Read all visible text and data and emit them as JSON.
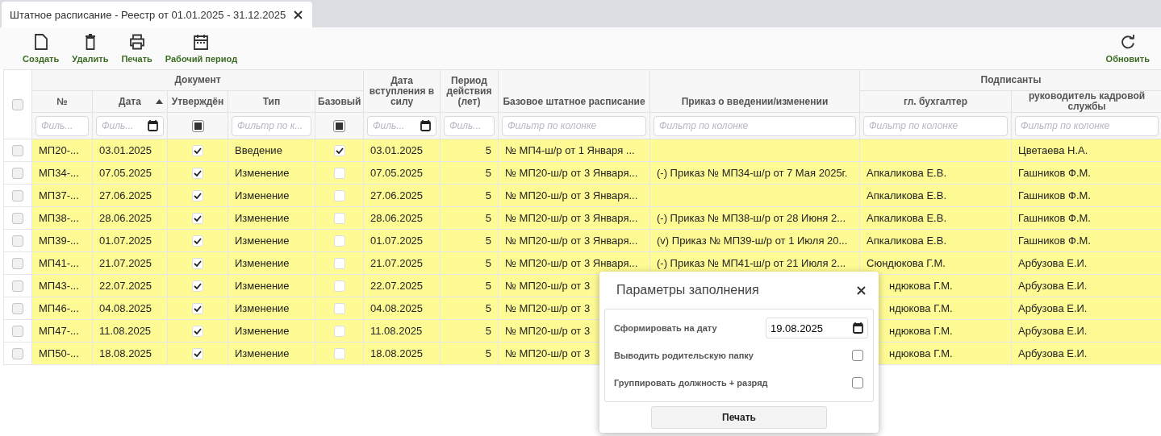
{
  "tab": {
    "title": "Штатное расписание - Реестр от 01.01.2025 - 31.12.2025",
    "closable": true
  },
  "toolbar": {
    "buttons": [
      {
        "kind": "create",
        "label": "Создать"
      },
      {
        "kind": "delete",
        "label": "Удалить"
      },
      {
        "kind": "print",
        "label": "Печать"
      },
      {
        "kind": "period",
        "label": "Рабочий период"
      }
    ],
    "refresh": {
      "kind": "refresh",
      "label": "Обновить"
    }
  },
  "table": {
    "select_all": {
      "checked": false
    },
    "header": [
      {
        "kind": "group",
        "label": "Документ",
        "columns": [
          {
            "label": "№",
            "kind": "text",
            "sorted": false,
            "filter": {
              "kind": "text",
              "placeholder": "Филь..."
            }
          },
          {
            "label": "Дата",
            "kind": "text",
            "sorted": true,
            "filter": {
              "kind": "date",
              "placeholder": "Филь..."
            }
          },
          {
            "label": "Утверждён",
            "kind": "check",
            "sorted": false,
            "filter": {
              "kind": "check",
              "indeterminate": true
            }
          },
          {
            "label": "Тип",
            "kind": "text",
            "sorted": false,
            "filter": {
              "kind": "text",
              "placeholder": "Фильтр по к..."
            }
          },
          {
            "label": "Базовый",
            "kind": "check",
            "sorted": false,
            "filter": {
              "kind": "check",
              "indeterminate": true
            }
          }
        ]
      },
      {
        "kind": "single",
        "column": {
          "label": "Дата вступления в силу",
          "kind": "text",
          "sorted": false,
          "filter": {
            "kind": "date",
            "placeholder": "Филь..."
          }
        }
      },
      {
        "kind": "single",
        "column": {
          "label": "Период действия (лет)",
          "kind": "number",
          "sorted": false,
          "filter": {
            "kind": "text",
            "placeholder": "Филь..."
          }
        }
      },
      {
        "kind": "single",
        "column": {
          "label": "Базовое штатное расписание",
          "kind": "text",
          "sorted": false,
          "filter": {
            "kind": "text",
            "placeholder": "Фильтр по колонке"
          }
        }
      },
      {
        "kind": "single",
        "column": {
          "label": "Приказ о введении/изменении",
          "kind": "text",
          "sorted": false,
          "filter": {
            "kind": "text",
            "placeholder": "Фильтр по колонке"
          }
        }
      },
      {
        "kind": "group",
        "label": "Подписанты",
        "columns": [
          {
            "label": "гл. бухгалтер",
            "kind": "text",
            "sorted": false,
            "filter": {
              "kind": "text",
              "placeholder": "Фильтр по колонке"
            }
          },
          {
            "label": "руководитель кадровой службы",
            "kind": "text",
            "sorted": false,
            "filter": {
              "kind": "text",
              "placeholder": "Фильтр по колонке"
            }
          }
        ]
      }
    ],
    "rows": [
      {
        "selected": false,
        "highlighted": true,
        "cells": [
          "МП20-...",
          "03.01.2025",
          true,
          "Введение",
          true,
          "03.01.2025",
          "5",
          "№ МП4-ш/р от 1 Января ...",
          null,
          null,
          "Цветаева Н.А."
        ]
      },
      {
        "selected": false,
        "highlighted": true,
        "cells": [
          "МП34-...",
          "07.05.2025",
          true,
          "Изменение",
          false,
          "07.05.2025",
          "5",
          "№ МП20-ш/р от 3 Января...",
          "(-) Приказ № МП34-ш/р от 7 Мая 2025г.",
          "Апкаликова Е.В.",
          "Гашников Ф.М."
        ]
      },
      {
        "selected": false,
        "highlighted": true,
        "cells": [
          "МП37-...",
          "27.06.2025",
          true,
          "Изменение",
          false,
          "27.06.2025",
          "5",
          "№ МП20-ш/р от 3 Января...",
          null,
          "Апкаликова Е.В.",
          "Гашников Ф.М."
        ]
      },
      {
        "selected": false,
        "highlighted": true,
        "cells": [
          "МП38-...",
          "28.06.2025",
          true,
          "Изменение",
          false,
          "28.06.2025",
          "5",
          "№ МП20-ш/р от 3 Января...",
          "(-) Приказ № МП38-ш/р от 28 Июня 2...",
          "Апкаликова Е.В.",
          "Гашников Ф.М."
        ]
      },
      {
        "selected": false,
        "highlighted": true,
        "cells": [
          "МП39-...",
          "01.07.2025",
          true,
          "Изменение",
          false,
          "01.07.2025",
          "5",
          "№ МП20-ш/р от 3 Января...",
          "(v) Приказ № МП39-ш/р от 1 Июля 20...",
          "Апкаликова Е.В.",
          "Гашников Ф.М."
        ]
      },
      {
        "selected": false,
        "highlighted": true,
        "cells": [
          "МП41-...",
          "21.07.2025",
          true,
          "Изменение",
          false,
          "21.07.2025",
          "5",
          "№ МП20-ш/р от 3 Января...",
          "(-) Приказ № МП41-ш/р от 21 Июля 2...",
          "Сюндюкова Г.М.",
          "Арбузова Е.И."
        ]
      },
      {
        "selected": false,
        "highlighted": true,
        "cells": [
          "МП43-...",
          "22.07.2025",
          true,
          "Изменение",
          false,
          "22.07.2025",
          "5",
          "№ МП20-ш/р от 3",
          null,
          "ндюкова Г.М.",
          "Арбузова Е.И."
        ]
      },
      {
        "selected": false,
        "highlighted": true,
        "cells": [
          "МП46-...",
          "04.08.2025",
          true,
          "Изменение",
          false,
          "04.08.2025",
          "5",
          "№ МП20-ш/р от 3",
          null,
          "ндюкова Г.М.",
          "Арбузова Е.И."
        ]
      },
      {
        "selected": false,
        "highlighted": true,
        "cells": [
          "МП47-...",
          "11.08.2025",
          true,
          "Изменение",
          false,
          "11.08.2025",
          "5",
          "№ МП20-ш/р от 3",
          null,
          "ндюкова Г.М.",
          "Арбузова Е.И."
        ]
      },
      {
        "selected": false,
        "highlighted": true,
        "cells": [
          "МП50-...",
          "18.08.2025",
          true,
          "Изменение",
          false,
          "18.08.2025",
          "5",
          "№ МП20-ш/р от 3",
          null,
          "ндюкова Г.М.",
          "Арбузова Е.И."
        ]
      }
    ]
  },
  "dialog": {
    "title": "Параметры заполнения",
    "closable": true,
    "fields": [
      {
        "kind": "date",
        "label": "Сформировать на дату",
        "value": "19.08.2025"
      },
      {
        "kind": "checkbox",
        "label": "Выводить родительскую папку",
        "checked": false
      },
      {
        "kind": "checkbox",
        "label": "Группировать должность + разряд",
        "checked": false
      }
    ],
    "button": "Печать"
  }
}
